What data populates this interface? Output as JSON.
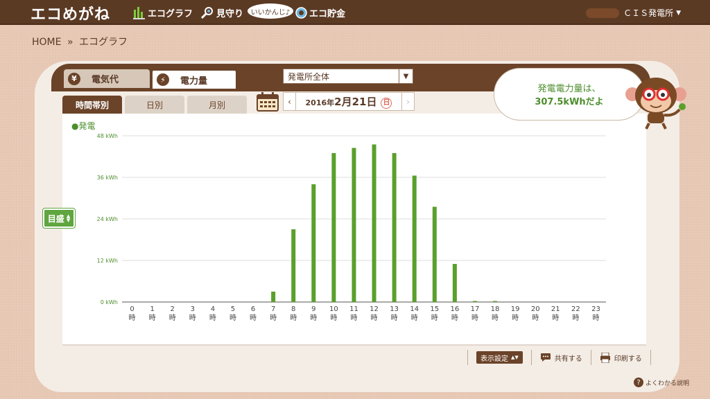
{
  "header": {
    "logo": "エコめがね",
    "nav": [
      {
        "label": "エコグラフ",
        "icon": "graph-icon"
      },
      {
        "label": "見守り",
        "icon": "magnifier-icon"
      },
      {
        "label": "エコ貯金",
        "icon": "coin-icon"
      }
    ],
    "bubble_tag": "いいかんじ♪",
    "user_name": "ＣＩＳ発電所"
  },
  "breadcrumb": {
    "home": "HOME",
    "separator": "»",
    "current": "エコグラフ"
  },
  "main_tabs": [
    {
      "label": "電気代",
      "icon_char": "¥",
      "active": false
    },
    {
      "label": "電力量",
      "icon_char": "⚡",
      "active": true
    }
  ],
  "site_select": {
    "value": "発電所全体"
  },
  "period_tabs": [
    {
      "label": "時間帯別",
      "active": true
    },
    {
      "label": "日別",
      "active": false
    },
    {
      "label": "月別",
      "active": false
    }
  ],
  "date": {
    "year_text": "2016年",
    "md_text": "2月21日",
    "weekday": "日"
  },
  "speech": {
    "line1": "発電電力量は、",
    "line2": "307.5kWhだよ"
  },
  "legend": "●発電",
  "scale_button": "目盛",
  "actions": {
    "display_setting": "表示設定",
    "share": "共有する",
    "print": "印刷する"
  },
  "help": "よくわかる説明",
  "chart_data": {
    "type": "bar",
    "series": [
      {
        "name": "発電",
        "values": [
          0,
          0,
          0,
          0,
          0,
          0,
          0,
          3,
          21,
          34,
          43,
          44.5,
          45.5,
          43,
          36.5,
          27.5,
          11,
          0.3,
          0.3,
          0,
          0,
          0,
          0,
          0
        ]
      }
    ],
    "categories": [
      "0",
      "1",
      "2",
      "3",
      "4",
      "5",
      "6",
      "7",
      "8",
      "9",
      "10",
      "11",
      "12",
      "13",
      "14",
      "15",
      "16",
      "17",
      "18",
      "19",
      "20",
      "21",
      "22",
      "23"
    ],
    "category_suffix": "時",
    "ylim": [
      0,
      48
    ],
    "yticks": [
      0,
      12,
      24,
      36,
      48
    ],
    "ytick_labels": [
      "0 kWh",
      "12 kWh",
      "24 kWh",
      "36 kWh",
      "48 kWh"
    ],
    "bar_color": "#5aa02c",
    "grid": true
  }
}
